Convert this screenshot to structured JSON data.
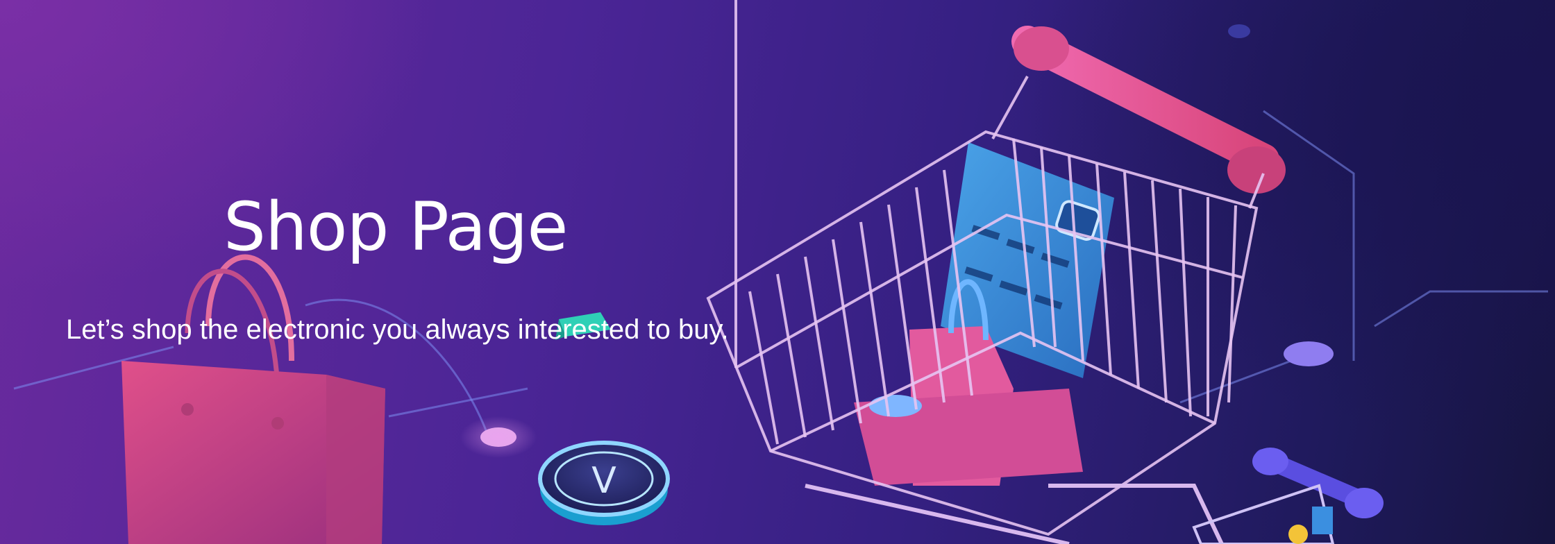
{
  "hero": {
    "title": "Shop Page",
    "subtitle": "Let’s shop the electronic you always interested to buy.",
    "illustration": {
      "shopping_bag_icon": "shopping-bag-icon",
      "shopping_cart_icon": "shopping-cart-icon",
      "credit_card_icon": "credit-card-icon",
      "verified_coin_icon": "check-coin-icon",
      "coin_glyph": "V"
    }
  },
  "colors": {
    "bg_left": "#6a2a9e",
    "bg_right": "#16143f",
    "cart_handle": "#e0508a",
    "card": "#3a8fd6",
    "text": "#ffffff"
  }
}
